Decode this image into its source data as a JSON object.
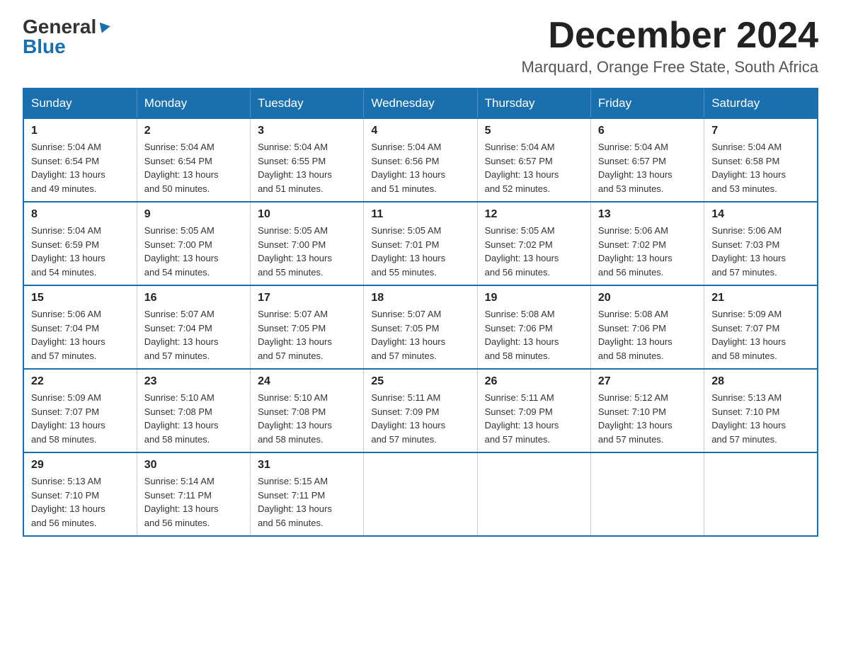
{
  "logo": {
    "general": "General",
    "blue": "Blue"
  },
  "title": "December 2024",
  "location": "Marquard, Orange Free State, South Africa",
  "days_of_week": [
    "Sunday",
    "Monday",
    "Tuesday",
    "Wednesday",
    "Thursday",
    "Friday",
    "Saturday"
  ],
  "weeks": [
    [
      {
        "day": "1",
        "sunrise": "5:04 AM",
        "sunset": "6:54 PM",
        "daylight": "13 hours and 49 minutes."
      },
      {
        "day": "2",
        "sunrise": "5:04 AM",
        "sunset": "6:54 PM",
        "daylight": "13 hours and 50 minutes."
      },
      {
        "day": "3",
        "sunrise": "5:04 AM",
        "sunset": "6:55 PM",
        "daylight": "13 hours and 51 minutes."
      },
      {
        "day": "4",
        "sunrise": "5:04 AM",
        "sunset": "6:56 PM",
        "daylight": "13 hours and 51 minutes."
      },
      {
        "day": "5",
        "sunrise": "5:04 AM",
        "sunset": "6:57 PM",
        "daylight": "13 hours and 52 minutes."
      },
      {
        "day": "6",
        "sunrise": "5:04 AM",
        "sunset": "6:57 PM",
        "daylight": "13 hours and 53 minutes."
      },
      {
        "day": "7",
        "sunrise": "5:04 AM",
        "sunset": "6:58 PM",
        "daylight": "13 hours and 53 minutes."
      }
    ],
    [
      {
        "day": "8",
        "sunrise": "5:04 AM",
        "sunset": "6:59 PM",
        "daylight": "13 hours and 54 minutes."
      },
      {
        "day": "9",
        "sunrise": "5:05 AM",
        "sunset": "7:00 PM",
        "daylight": "13 hours and 54 minutes."
      },
      {
        "day": "10",
        "sunrise": "5:05 AM",
        "sunset": "7:00 PM",
        "daylight": "13 hours and 55 minutes."
      },
      {
        "day": "11",
        "sunrise": "5:05 AM",
        "sunset": "7:01 PM",
        "daylight": "13 hours and 55 minutes."
      },
      {
        "day": "12",
        "sunrise": "5:05 AM",
        "sunset": "7:02 PM",
        "daylight": "13 hours and 56 minutes."
      },
      {
        "day": "13",
        "sunrise": "5:06 AM",
        "sunset": "7:02 PM",
        "daylight": "13 hours and 56 minutes."
      },
      {
        "day": "14",
        "sunrise": "5:06 AM",
        "sunset": "7:03 PM",
        "daylight": "13 hours and 57 minutes."
      }
    ],
    [
      {
        "day": "15",
        "sunrise": "5:06 AM",
        "sunset": "7:04 PM",
        "daylight": "13 hours and 57 minutes."
      },
      {
        "day": "16",
        "sunrise": "5:07 AM",
        "sunset": "7:04 PM",
        "daylight": "13 hours and 57 minutes."
      },
      {
        "day": "17",
        "sunrise": "5:07 AM",
        "sunset": "7:05 PM",
        "daylight": "13 hours and 57 minutes."
      },
      {
        "day": "18",
        "sunrise": "5:07 AM",
        "sunset": "7:05 PM",
        "daylight": "13 hours and 57 minutes."
      },
      {
        "day": "19",
        "sunrise": "5:08 AM",
        "sunset": "7:06 PM",
        "daylight": "13 hours and 58 minutes."
      },
      {
        "day": "20",
        "sunrise": "5:08 AM",
        "sunset": "7:06 PM",
        "daylight": "13 hours and 58 minutes."
      },
      {
        "day": "21",
        "sunrise": "5:09 AM",
        "sunset": "7:07 PM",
        "daylight": "13 hours and 58 minutes."
      }
    ],
    [
      {
        "day": "22",
        "sunrise": "5:09 AM",
        "sunset": "7:07 PM",
        "daylight": "13 hours and 58 minutes."
      },
      {
        "day": "23",
        "sunrise": "5:10 AM",
        "sunset": "7:08 PM",
        "daylight": "13 hours and 58 minutes."
      },
      {
        "day": "24",
        "sunrise": "5:10 AM",
        "sunset": "7:08 PM",
        "daylight": "13 hours and 58 minutes."
      },
      {
        "day": "25",
        "sunrise": "5:11 AM",
        "sunset": "7:09 PM",
        "daylight": "13 hours and 57 minutes."
      },
      {
        "day": "26",
        "sunrise": "5:11 AM",
        "sunset": "7:09 PM",
        "daylight": "13 hours and 57 minutes."
      },
      {
        "day": "27",
        "sunrise": "5:12 AM",
        "sunset": "7:10 PM",
        "daylight": "13 hours and 57 minutes."
      },
      {
        "day": "28",
        "sunrise": "5:13 AM",
        "sunset": "7:10 PM",
        "daylight": "13 hours and 57 minutes."
      }
    ],
    [
      {
        "day": "29",
        "sunrise": "5:13 AM",
        "sunset": "7:10 PM",
        "daylight": "13 hours and 56 minutes."
      },
      {
        "day": "30",
        "sunrise": "5:14 AM",
        "sunset": "7:11 PM",
        "daylight": "13 hours and 56 minutes."
      },
      {
        "day": "31",
        "sunrise": "5:15 AM",
        "sunset": "7:11 PM",
        "daylight": "13 hours and 56 minutes."
      },
      null,
      null,
      null,
      null
    ]
  ],
  "labels": {
    "sunrise": "Sunrise:",
    "sunset": "Sunset:",
    "daylight": "Daylight:"
  }
}
